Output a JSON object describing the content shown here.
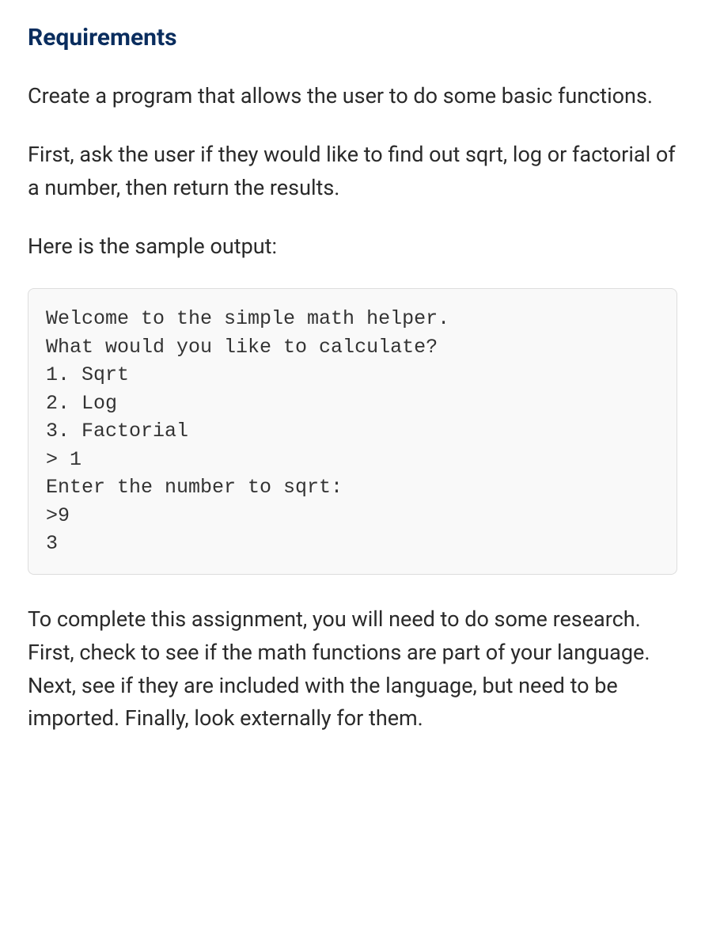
{
  "heading": "Requirements",
  "paragraphs": {
    "intro": "Create a program that allows the user to do some basic functions.",
    "task": "First, ask the user if they would like to find out sqrt, log or factorial of a number, then return the results.",
    "sample_label": "Here is the sample output:",
    "conclusion": "To complete this assignment, you will need to do some research. First, check to see if the math functions are part of your language. Next, see if they are included with the language, but need to be imported. Finally, look externally for them."
  },
  "code_sample": "Welcome to the simple math helper.\nWhat would you like to calculate?\n1. Sqrt\n2. Log\n3. Factorial\n> 1\nEnter the number to sqrt:\n>9\n3"
}
